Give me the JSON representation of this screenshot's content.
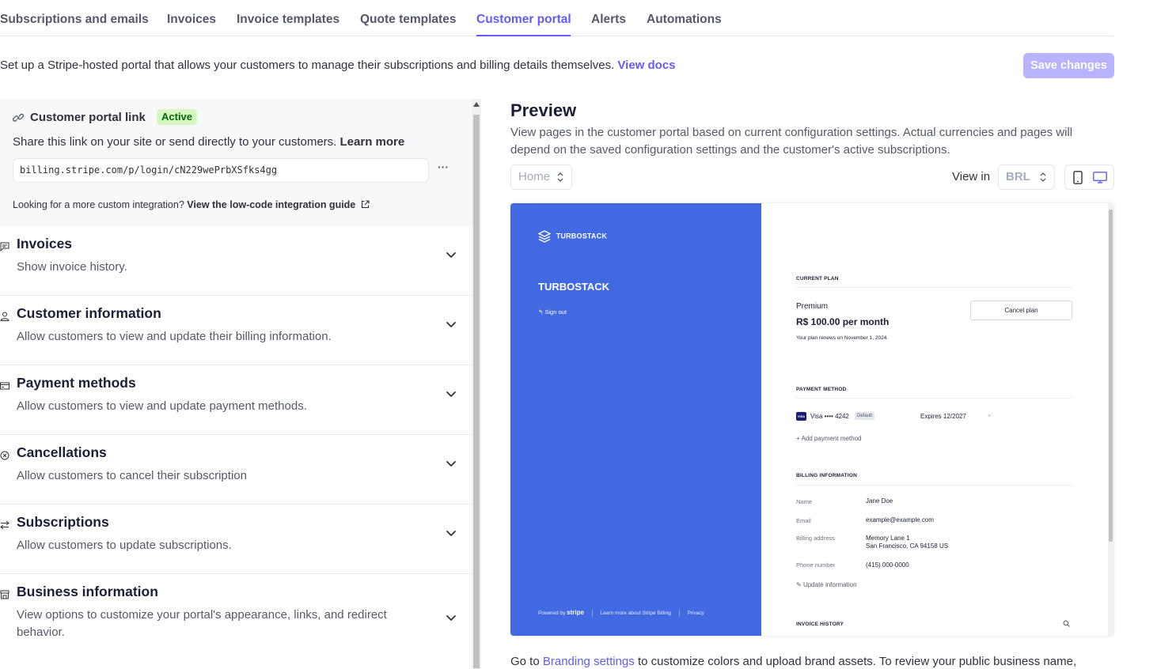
{
  "tabs": [
    {
      "label": "Subscriptions and emails",
      "active": false
    },
    {
      "label": "Invoices",
      "active": false
    },
    {
      "label": "Invoice templates",
      "active": false
    },
    {
      "label": "Quote templates",
      "active": false
    },
    {
      "label": "Customer portal",
      "active": true
    },
    {
      "label": "Alerts",
      "active": false
    },
    {
      "label": "Automations",
      "active": false
    }
  ],
  "intro": {
    "text": "Set up a Stripe-hosted portal that allows your customers to manage their subscriptions and billing details themselves.",
    "link": "View docs"
  },
  "save_label": "Save changes",
  "portal_link": {
    "title": "Customer portal link",
    "badge": "Active",
    "share_text": "Share this link on your site or send directly to your customers.",
    "learn_more": "Learn more",
    "url": "billing.stripe.com/p/login/cN229wePrbXSfks4gg",
    "more": "···",
    "lowcode_text": "Looking for a more custom integration?",
    "lowcode_link": "View the low-code integration guide"
  },
  "sections": [
    {
      "title": "Invoices",
      "desc": "Show invoice history.",
      "icon": "invoice-icon"
    },
    {
      "title": "Customer information",
      "desc": "Allow customers to view and update their billing information.",
      "icon": "person-icon"
    },
    {
      "title": "Payment methods",
      "desc": "Allow customers to view and update payment methods.",
      "icon": "card-icon"
    },
    {
      "title": "Cancellations",
      "desc": "Allow customers to cancel their subscription",
      "icon": "cancel-circle-icon"
    },
    {
      "title": "Subscriptions",
      "desc": "Allow customers to update subscriptions.",
      "icon": "swap-arrows-icon"
    },
    {
      "title": "Business information",
      "desc": "View options to customize your portal's appearance, links, and redirect behavior.",
      "icon": "store-icon"
    }
  ],
  "preview": {
    "title": "Preview",
    "desc": "View pages in the customer portal based on current configuration settings. Actual currencies and pages will depend on the saved configuration settings and the customer's active subscriptions.",
    "page_select": "Home",
    "view_in": "View in",
    "currency": "BRL"
  },
  "portal_preview": {
    "brand_logo_text": "TURBOSTACK",
    "brand_name": "TURBOSTACK",
    "sign_out": "Sign out",
    "footer_powered": "Powered by",
    "footer_stripe": "stripe",
    "footer_learn": "Learn more about Stripe Billing",
    "footer_privacy": "Privacy",
    "current_plan_label": "CURRENT PLAN",
    "plan_name": "Premium",
    "plan_price": "R$ 100.00 per month",
    "plan_renews": "Your plan renews on November 1, 2024.",
    "cancel_plan": "Cancel plan",
    "payment_method_label": "PAYMENT METHOD",
    "visa_badge": "VISA",
    "card": "Visa •••• 4242",
    "default_badge": "Default",
    "expires": "Expires 12/2027",
    "remove": "×",
    "add_payment": "Add payment method",
    "billing_label": "BILLING INFORMATION",
    "billing_rows": [
      {
        "label": "Name",
        "value": "Jane Doe"
      },
      {
        "label": "Email",
        "value": "example@example.com"
      },
      {
        "label": "Billing address",
        "value": "Memory Lane 1",
        "value2": "San Francisco, CA 94158 US"
      },
      {
        "label": "Phone number",
        "value": "(415) 000-0000"
      }
    ],
    "update_info": "Update information",
    "invoice_history_label": "INVOICE HISTORY"
  },
  "bottom_note": {
    "prefix": "Go to",
    "link": "Branding settings",
    "suffix": "to customize colors and upload brand assets. To review your public business name,"
  },
  "colors": {
    "accent": "#635bff",
    "portal_brand": "#4169e1",
    "active_badge_bg": "#d7f7c2"
  }
}
